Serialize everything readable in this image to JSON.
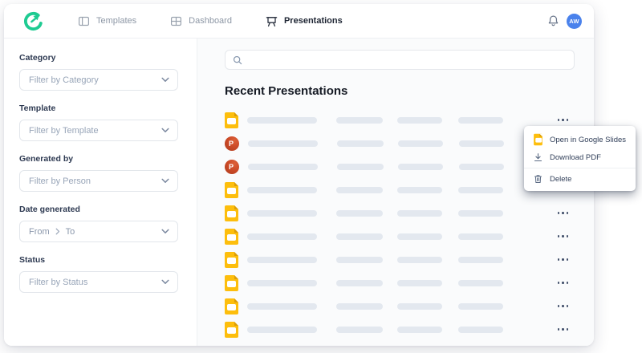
{
  "navbar": {
    "brand_icon": "brand-circle-arrow-logo",
    "items": [
      {
        "label": "Templates",
        "icon": "templates-panel-icon",
        "active": false
      },
      {
        "label": "Dashboard",
        "icon": "dashboard-grid-icon",
        "active": false
      },
      {
        "label": "Presentations",
        "icon": "presentation-screen-icon",
        "active": true
      }
    ],
    "bell_icon": "notification-bell-icon",
    "avatar": {
      "initials": "AW",
      "color": "#4A82EC"
    }
  },
  "sidebar": {
    "filters": [
      {
        "label": "Category",
        "placeholder": "Filter by Category"
      },
      {
        "label": "Template",
        "placeholder": "Filter by Template"
      },
      {
        "label": "Generated by",
        "placeholder": "Filter by Person"
      },
      {
        "label": "Date generated",
        "type": "date-range",
        "from_label": "From",
        "to_label": "To"
      },
      {
        "label": "Status",
        "placeholder": "Filter by Status"
      }
    ]
  },
  "main": {
    "search": {
      "placeholder": "",
      "icon": "search-icon"
    },
    "heading": "Recent Presentations",
    "rows": [
      {
        "file_type": "google-slides"
      },
      {
        "file_type": "powerpoint"
      },
      {
        "file_type": "powerpoint"
      },
      {
        "file_type": "google-slides"
      },
      {
        "file_type": "google-slides"
      },
      {
        "file_type": "google-slides"
      },
      {
        "file_type": "google-slides"
      },
      {
        "file_type": "google-slides"
      },
      {
        "file_type": "google-slides"
      },
      {
        "file_type": "google-slides"
      }
    ]
  },
  "context_menu": {
    "items": [
      {
        "label": "Open in Google Slides",
        "icon": "google-slides-icon"
      },
      {
        "label": "Download PDF",
        "icon": "download-icon"
      },
      {
        "label": "Delete",
        "icon": "trash-icon",
        "divider_above": true
      }
    ]
  },
  "colors": {
    "accent_green": "#1FCB92",
    "slides_yellow": "#FDBE0D",
    "powerpoint_red": "#C6492A",
    "avatar_blue": "#4A82EC",
    "skeleton_bar": "#E3E8EF",
    "main_background": "#FAFBFC"
  }
}
